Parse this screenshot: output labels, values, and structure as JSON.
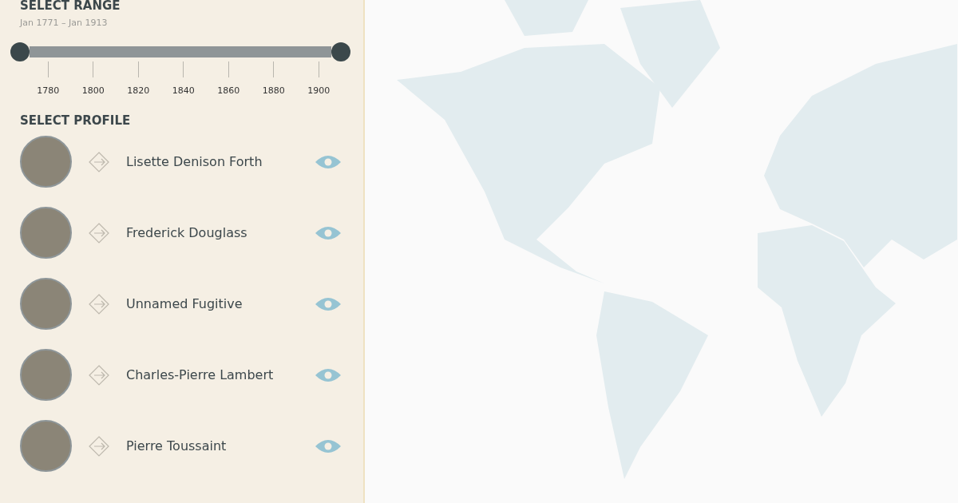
{
  "range": {
    "title": "SELECT RANGE",
    "subtitle": "Jan 1771 – Jan 1913",
    "level": 1,
    "ticks": [
      "1780",
      "1800",
      "1820",
      "1840",
      "1860",
      "1880",
      "1900"
    ]
  },
  "profile": {
    "title": "SELECT PROFILE",
    "items": [
      {
        "name": "Lisette Denison Forth"
      },
      {
        "name": "Frederick Douglass"
      },
      {
        "name": "Unnamed Fugitive"
      },
      {
        "name": "Charles-Pierre Lambert"
      },
      {
        "name": "Pierre Toussaint"
      }
    ]
  }
}
